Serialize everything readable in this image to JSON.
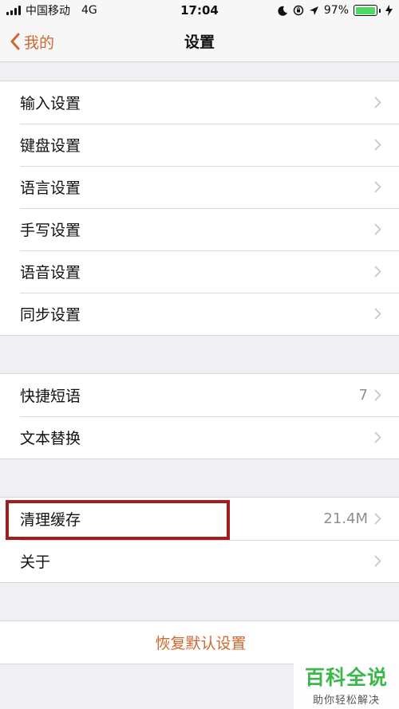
{
  "status_bar": {
    "carrier": "中国移动",
    "network": "4G",
    "time": "17:04",
    "battery_percent": "97%",
    "battery_level": 0.97
  },
  "nav": {
    "back_label": "我的",
    "title": "设置"
  },
  "groups": [
    {
      "items": [
        {
          "label": "输入设置",
          "value": ""
        },
        {
          "label": "键盘设置",
          "value": ""
        },
        {
          "label": "语言设置",
          "value": ""
        },
        {
          "label": "手写设置",
          "value": ""
        },
        {
          "label": "语音设置",
          "value": ""
        },
        {
          "label": "同步设置",
          "value": ""
        }
      ]
    },
    {
      "items": [
        {
          "label": "快捷短语",
          "value": "7"
        },
        {
          "label": "文本替换",
          "value": ""
        }
      ]
    },
    {
      "items": [
        {
          "label": "清理缓存",
          "value": "21.4M"
        },
        {
          "label": "关于",
          "value": ""
        }
      ]
    }
  ],
  "reset_label": "恢复默认设置",
  "watermark": {
    "title": "百科全说",
    "subtitle": "助你轻松解决"
  },
  "colors": {
    "accent": "#d0672f",
    "highlight": "#a31d1d",
    "watermark_green": "#3cb84a",
    "background": "#efeff4"
  }
}
